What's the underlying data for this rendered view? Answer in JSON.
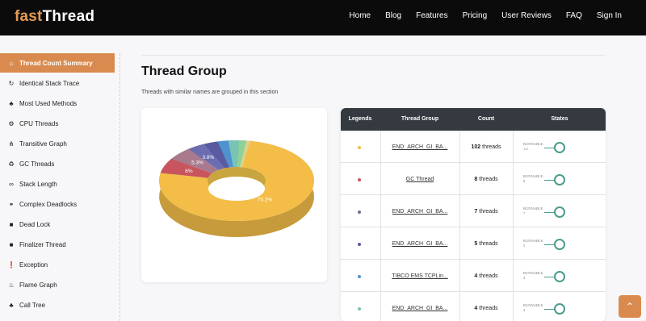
{
  "brand": {
    "part1": "fast",
    "part2": "Thread"
  },
  "nav": [
    "Home",
    "Blog",
    "Features",
    "Pricing",
    "User Reviews",
    "FAQ",
    "Sign In"
  ],
  "sidebar": [
    {
      "label": "Thread Count Summary",
      "icon": "home-icon",
      "glyph": "⌂",
      "active": true
    },
    {
      "label": "Identical Stack Trace",
      "icon": "refresh-icon",
      "glyph": "↻"
    },
    {
      "label": "Most Used Methods",
      "icon": "users-icon",
      "glyph": "♣"
    },
    {
      "label": "CPU Threads",
      "icon": "cogs-icon",
      "glyph": "⚙"
    },
    {
      "label": "Transitive Graph",
      "icon": "graph-icon",
      "glyph": "⋔"
    },
    {
      "label": "GC Threads",
      "icon": "recycle-icon",
      "glyph": "♻"
    },
    {
      "label": "Stack Length",
      "icon": "link-icon",
      "glyph": "∞"
    },
    {
      "label": "Complex Deadlocks",
      "icon": "chain-icon",
      "glyph": "⚭"
    },
    {
      "label": "Dead Lock",
      "icon": "lock-icon",
      "glyph": "■"
    },
    {
      "label": "Finalizer Thread",
      "icon": "square-icon",
      "glyph": "■"
    },
    {
      "label": "Exception",
      "icon": "exclamation-icon",
      "glyph": "❗"
    },
    {
      "label": "Flame Graph",
      "icon": "fire-icon",
      "glyph": "♨"
    },
    {
      "label": "Call Tree",
      "icon": "tree-icon",
      "glyph": "♣"
    }
  ],
  "main": {
    "title": "Thread Group",
    "subtitle": "Threads with similar names are grouped in this section"
  },
  "chart_data": {
    "type": "pie",
    "style": "3d-donut",
    "labels": [
      "75.2%",
      "6%",
      "5.3%",
      "3.8%"
    ],
    "values": [
      75.2,
      6.0,
      5.3,
      3.8,
      2.9,
      2.2,
      2.2,
      1.5,
      0.9
    ],
    "colors": [
      "#f3bd48",
      "#c8555d",
      "#a97a8e",
      "#6b6db0",
      "#5a5aa0",
      "#4e92d0",
      "#78c3b4",
      "#8dd09a",
      "#dcd28a"
    ]
  },
  "table": {
    "headers": [
      "Legends",
      "Thread Group",
      "Count",
      "States"
    ],
    "rows": [
      {
        "color": "#f3bd48",
        "group": "END_ARCH_GI_BA...",
        "count": "102",
        "unit": "threads",
        "state": "RUNNABLE",
        "state_count": "1/2"
      },
      {
        "color": "#c8555d",
        "group": "GC Thread",
        "count": "8",
        "unit": "threads",
        "state": "RUNNABLE",
        "state_count": "8"
      },
      {
        "color": "#6a6e90",
        "group": "END_ARCH_GI_BA...",
        "count": "7",
        "unit": "threads",
        "state": "RUNNABLE",
        "state_count": "7"
      },
      {
        "color": "#5a5aa0",
        "group": "END_ARCH_GI_BA...",
        "count": "5",
        "unit": "threads",
        "state": "RUNNABLE",
        "state_count": "5"
      },
      {
        "color": "#4e92d0",
        "group": "TIBCO EMS TCPLin...",
        "count": "4",
        "unit": "threads",
        "state": "RUNNABLE",
        "state_count": "4"
      },
      {
        "color": "#78c3b4",
        "group": "END_ARCH_GI_BA...",
        "count": "4",
        "unit": "threads",
        "state": "RUNNABLE",
        "state_count": "4"
      }
    ]
  },
  "scroll_top": {
    "icon": "chevron-up-icon",
    "glyph": "⌃"
  }
}
